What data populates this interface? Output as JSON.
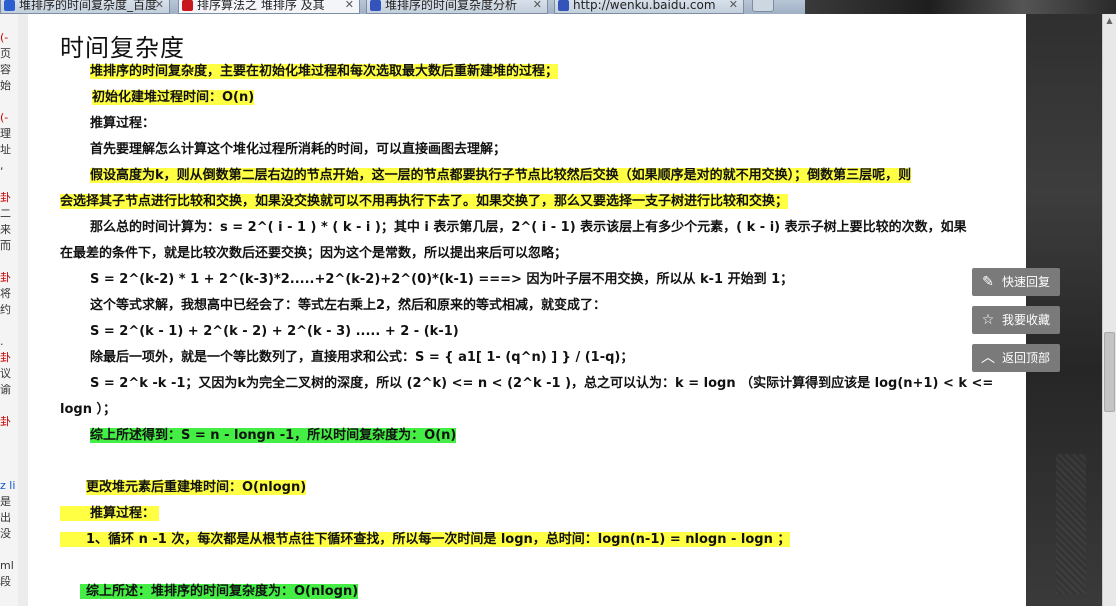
{
  "tabs": [
    {
      "label": "堆排序的时间复杂度_百度",
      "fav_color": "#2b5fd0"
    },
    {
      "label": "排序算法之 堆排序 及其",
      "fav_color": "#c8161d"
    },
    {
      "label": "堆排序的时间复杂度分析",
      "fav_color": "#3355bb"
    },
    {
      "label": "http://wenku.baidu.com",
      "fav_color": "#3355bb"
    }
  ],
  "left_fragments": [
    "(-",
    "页",
    "容",
    "始",
    "",
    "(-",
    "理",
    "址",
    ",",
    "",
    "卦",
    "二",
    "来",
    "而",
    "",
    "卦",
    "将",
    "约",
    "",
    ".",
    "卦",
    "议",
    "谕",
    "",
    "卦",
    "",
    "",
    "",
    "z li",
    "是",
    "出",
    "没",
    "",
    "ml",
    "段"
  ],
  "article": {
    "title": "时间复杂度",
    "lines": [
      {
        "text": "堆排序的时间复杂度，主要在初始化堆过程和每次选取最大数后重新建堆的过程；",
        "hl": "y"
      },
      {
        "text": " 初始化建堆过程时间：O(n)",
        "hl": "y"
      },
      {
        "text": "推算过程：",
        "hl": ""
      },
      {
        "text": "首先要理解怎么计算这个堆化过程所消耗的时间，可以直接画图去理解；",
        "hl": ""
      },
      {
        "text": "假设高度为k，则从倒数第二层右边的节点开始，这一层的节点都要执行子节点比较然后交换（如果顺序是对的就不用交换）；倒数第三层呢，则",
        "hl": "y"
      },
      {
        "text": "会选择其子节点进行比较和交换，如果没交换就可以不用再执行下去了。如果交换了，那么又要选择一支子树进行比较和交换；",
        "hl": "y"
      },
      {
        "text": "那么总的时间计算为：s = 2^( i - 1 ) * ( k - i )；其中 i 表示第几层，2^( i - 1) 表示该层上有多少个元素，( k - i) 表示子树上要比较的次数，如果",
        "hl": ""
      },
      {
        "text": "在最差的条件下，就是比较次数后还要交换；因为这个是常数，所以提出来后可以忽略；",
        "hl": ""
      },
      {
        "text": "S = 2^(k-2) * 1 + 2^(k-3)*2.....+2^(k-2)+2^(0)*(k-1)  ===> 因为叶子层不用交换，所以从 k-1 开始到 1；",
        "hl": ""
      },
      {
        "text": "这个等式求解，我想高中已经会了：等式左右乘上2，然后和原来的等式相减，就变成了：",
        "hl": ""
      },
      {
        "text": "S = 2^(k - 1) + 2^(k - 2) + 2^(k - 3) ..... + 2 - (k-1)",
        "hl": ""
      },
      {
        "text": "除最后一项外，就是一个等比数列了，直接用求和公式：S = {  a1[ 1-  (q^n) ] }  / (1-q)；",
        "hl": ""
      },
      {
        "text": "S = 2^k -k -1；又因为k为完全二叉树的深度，所以 (2^k) <=  n < (2^k  -1 )，总之可以认为：k = logn （实际计算得到应该是 log(n+1) < k <=",
        "hl": ""
      },
      {
        "text": "logn ）；",
        "hl": ""
      },
      {
        "text": "综上所述得到：S = n - longn -1，所以时间复杂度为：O(n)",
        "hl": "g"
      },
      {
        "text": "更改堆元素后重建堆时间：O(nlogn)",
        "hl": "y"
      },
      {
        "text": "推算过程：",
        "hl": "y"
      },
      {
        "text": "1、循环  n -1 次，每次都是从根节点往下循环查找，所以每一次时间是 logn，总时间：logn(n-1) = nlogn  - logn ；",
        "hl": "y"
      },
      {
        "text": "综上所述：堆排序的时间复杂度为：O(nlogn)",
        "hl": "g"
      }
    ]
  },
  "float_buttons": [
    {
      "label": "快速回复",
      "icon": "pencil-icon",
      "glyph": "✎"
    },
    {
      "label": "我要收藏",
      "icon": "star-icon",
      "glyph": "☆"
    },
    {
      "label": "返回顶部",
      "icon": "chevron-up-icon",
      "glyph": "︿"
    }
  ],
  "colors": {
    "highlight_yellow": "#ffff44",
    "highlight_green": "#44ee44",
    "float_button_bg": "#7a7a7a"
  }
}
